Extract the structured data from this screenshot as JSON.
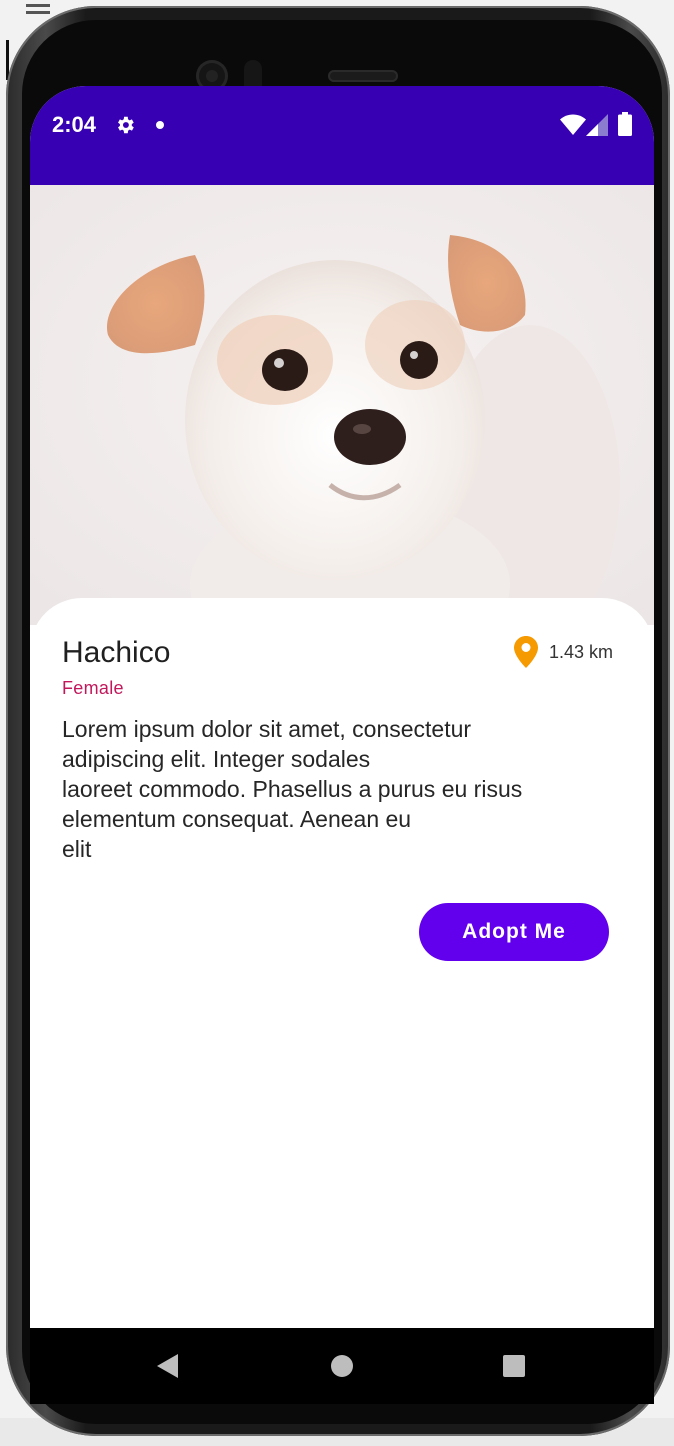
{
  "status_bar": {
    "time": "2:04",
    "icons": [
      "settings-gear-icon",
      "notification-dot-icon",
      "wifi-icon",
      "cell-signal-icon",
      "battery-icon"
    ],
    "background": "#3700b3"
  },
  "pet": {
    "photo": "white-puppy-photo",
    "name": "Hachico",
    "gender": "Female",
    "distance": "1.43 km",
    "description": "Lorem ipsum dolor sit amet, consectetur\nadipiscing elit. Integer sodales\nlaoreet commodo. Phasellus a purus eu risus\nelementum consequat. Aenean eu\nelit",
    "gender_color": "#c2185b",
    "pin_color": "#f59a00"
  },
  "actions": {
    "adopt_label": "Adopt Me",
    "adopt_color": "#6200ee"
  },
  "nav_bar": {
    "buttons": [
      "back-icon",
      "home-icon",
      "recents-icon"
    ]
  }
}
